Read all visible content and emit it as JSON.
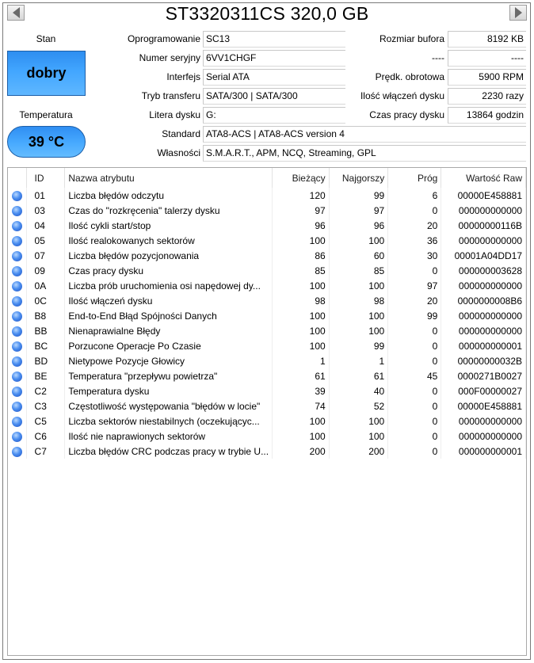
{
  "header": {
    "title": "ST3320311CS 320,0 GB",
    "prev_icon": "triangle-left-icon",
    "next_icon": "triangle-right-icon"
  },
  "status": {
    "health_label": "Stan",
    "health_value": "dobry",
    "temperature_label": "Temperatura",
    "temperature_value": "39 °C",
    "health_color": "#42a6ff"
  },
  "info_left": [
    {
      "label": "Oprogramowanie",
      "value": "SC13"
    },
    {
      "label": "Numer seryjny",
      "value": "6VV1CHGF"
    },
    {
      "label": "Interfejs",
      "value": "Serial ATA"
    },
    {
      "label": "Tryb transferu",
      "value": "SATA/300 | SATA/300"
    },
    {
      "label": "Litera dysku",
      "value": "G:"
    }
  ],
  "info_right": [
    {
      "label": "Rozmiar bufora",
      "value": "8192 KB"
    },
    {
      "label": "----",
      "value": "----"
    },
    {
      "label": "Prędk. obrotowa",
      "value": "5900 RPM"
    },
    {
      "label": "Ilość włączeń dysku",
      "value": "2230 razy"
    },
    {
      "label": "Czas pracy dysku",
      "value": "13864 godzin"
    }
  ],
  "info_wide": [
    {
      "label": "Standard",
      "value": "ATA8-ACS | ATA8-ACS version 4"
    },
    {
      "label": "Własności",
      "value": "S.M.A.R.T., APM, NCQ, Streaming, GPL"
    }
  ],
  "smart": {
    "columns": [
      "",
      "ID",
      "Nazwa atrybutu",
      "Bieżący",
      "Najgorszy",
      "Próg",
      "Wartość Raw"
    ],
    "rows": [
      {
        "id": "01",
        "name": "Liczba błędów odczytu",
        "current": "120",
        "worst": "99",
        "threshold": "6",
        "raw": "00000E458881"
      },
      {
        "id": "03",
        "name": "Czas do \"rozkręcenia\" talerzy dysku",
        "current": "97",
        "worst": "97",
        "threshold": "0",
        "raw": "000000000000"
      },
      {
        "id": "04",
        "name": "Ilość cykli start/stop",
        "current": "96",
        "worst": "96",
        "threshold": "20",
        "raw": "00000000116B"
      },
      {
        "id": "05",
        "name": "Ilość realokowanych sektorów",
        "current": "100",
        "worst": "100",
        "threshold": "36",
        "raw": "000000000000"
      },
      {
        "id": "07",
        "name": "Liczba błędów pozycjonowania",
        "current": "86",
        "worst": "60",
        "threshold": "30",
        "raw": "00001A04DD17"
      },
      {
        "id": "09",
        "name": "Czas pracy dysku",
        "current": "85",
        "worst": "85",
        "threshold": "0",
        "raw": "000000003628"
      },
      {
        "id": "0A",
        "name": "Liczba prób uruchomienia osi napędowej dy...",
        "current": "100",
        "worst": "100",
        "threshold": "97",
        "raw": "000000000000"
      },
      {
        "id": "0C",
        "name": "Ilość włączeń dysku",
        "current": "98",
        "worst": "98",
        "threshold": "20",
        "raw": "0000000008B6"
      },
      {
        "id": "B8",
        "name": "End-to-End Błąd Spójności Danych",
        "current": "100",
        "worst": "100",
        "threshold": "99",
        "raw": "000000000000"
      },
      {
        "id": "BB",
        "name": "Nienaprawialne Błędy",
        "current": "100",
        "worst": "100",
        "threshold": "0",
        "raw": "000000000000"
      },
      {
        "id": "BC",
        "name": "Porzucone Operacje Po Czasie",
        "current": "100",
        "worst": "99",
        "threshold": "0",
        "raw": "000000000001"
      },
      {
        "id": "BD",
        "name": "Nietypowe Pozycje Głowicy",
        "current": "1",
        "worst": "1",
        "threshold": "0",
        "raw": "00000000032B"
      },
      {
        "id": "BE",
        "name": "Temperatura \"przepływu powietrza\"",
        "current": "61",
        "worst": "61",
        "threshold": "45",
        "raw": "0000271B0027"
      },
      {
        "id": "C2",
        "name": "Temperatura dysku",
        "current": "39",
        "worst": "40",
        "threshold": "0",
        "raw": "000F00000027"
      },
      {
        "id": "C3",
        "name": "Częstotliwość występowania \"błędów w locie\"",
        "current": "74",
        "worst": "52",
        "threshold": "0",
        "raw": "00000E458881"
      },
      {
        "id": "C5",
        "name": "Liczba sektorów niestabilnych (oczekującyc...",
        "current": "100",
        "worst": "100",
        "threshold": "0",
        "raw": "000000000000"
      },
      {
        "id": "C6",
        "name": "Ilość nie naprawionych sektorów",
        "current": "100",
        "worst": "100",
        "threshold": "0",
        "raw": "000000000000"
      },
      {
        "id": "C7",
        "name": "Liczba błędów CRC podczas pracy w trybie U...",
        "current": "200",
        "worst": "200",
        "threshold": "0",
        "raw": "000000000001"
      }
    ]
  }
}
